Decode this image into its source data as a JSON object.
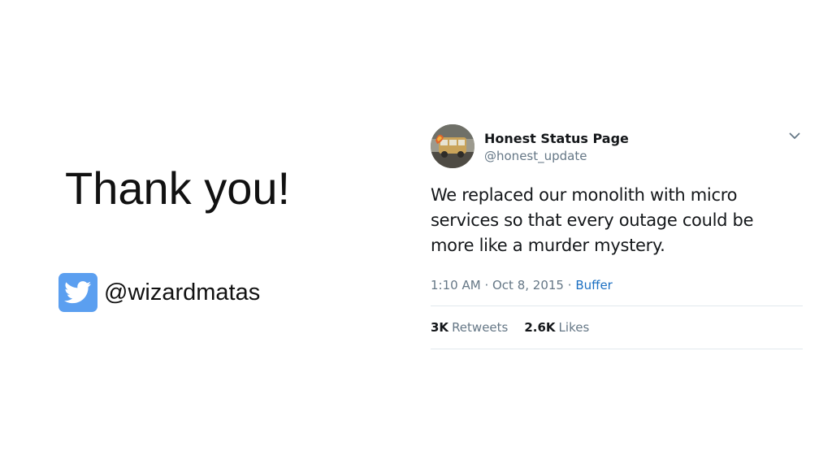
{
  "slide": {
    "heading": "Thank you!",
    "twitter_handle": "@wizardmatas",
    "twitter_icon": "twitter-bird-icon",
    "twitter_icon_color": "#5b9ff0"
  },
  "tweet": {
    "display_name": "Honest Status Page",
    "username": "@honest_update",
    "menu_icon": "chevron-down-icon",
    "text_lines": [
      "We replaced our monolith with micro",
      "services so that every outage could be",
      "more like a murder mystery."
    ],
    "time": "1:10 AM",
    "dot": "·",
    "date": "Oct 8, 2015",
    "source": "Buffer",
    "retweets_count": "3K",
    "retweets_label": "Retweets",
    "likes_count": "2.6K",
    "likes_label": "Likes",
    "link_color": "#1b6fc2",
    "muted_color": "#657786"
  }
}
